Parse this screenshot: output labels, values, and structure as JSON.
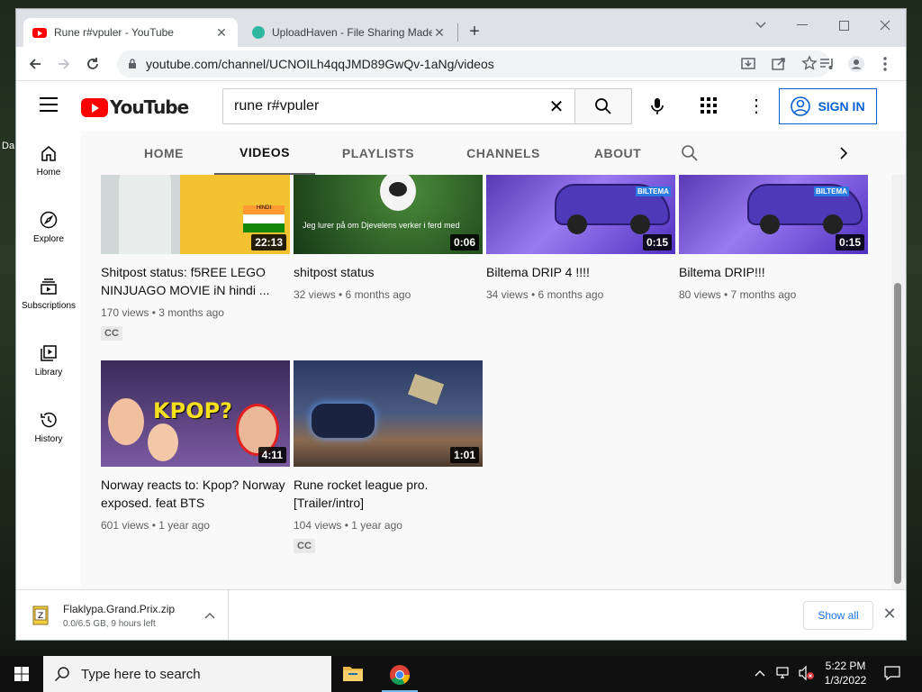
{
  "browser": {
    "tabs": [
      {
        "title": "Rune r#vpuler - YouTube",
        "active": true
      },
      {
        "title": "UploadHaven - File Sharing Made Simple",
        "active": false
      }
    ],
    "url": "youtube.com/channel/UCNOILh4qqJMD89GwQv-1aNg/videos"
  },
  "youtube": {
    "logo_text": "YouTube",
    "search_query": "rune r#vpuler",
    "sign_in_label": "SIGN IN",
    "guide": [
      {
        "label": "Home",
        "icon": "home-icon"
      },
      {
        "label": "Explore",
        "icon": "compass-icon"
      },
      {
        "label": "Subscriptions",
        "icon": "subscriptions-icon"
      },
      {
        "label": "Library",
        "icon": "library-icon"
      },
      {
        "label": "History",
        "icon": "history-icon"
      }
    ],
    "channel_tabs": [
      "HOME",
      "VIDEOS",
      "PLAYLISTS",
      "CHANNELS",
      "ABOUT"
    ],
    "active_tab": "VIDEOS",
    "videos": [
      {
        "title": "Shitpost status: f5REE LEGO NINJUAGO MOVIE iN hindi ...",
        "meta": "170 views • 3 months ago",
        "duration": "22:13",
        "cc": "CC",
        "flag_label": "HINDI",
        "thumb_color": "#f2c230"
      },
      {
        "title": "shitpost status",
        "meta": "32 views • 6 months ago",
        "duration": "0:06",
        "cc": "",
        "caption_text": "Jeg lurer på om Djevelens verker i ferd med å få deg ut av fokus og bort fra",
        "thumb_color": "#2a5a2a"
      },
      {
        "title": "Biltema DRIP 4 !!!!",
        "meta": "34 views • 6 months ago",
        "duration": "0:15",
        "cc": "",
        "badge_text": "BILTEMA",
        "thumb_color": "#6a40d0"
      },
      {
        "title": "Biltema DRIP!!!",
        "meta": "80 views • 7 months ago",
        "duration": "0:15",
        "cc": "",
        "badge_text": "BILTEMA",
        "thumb_color": "#6a40d0"
      },
      {
        "title": "Norway reacts to: Kpop? Norway exposed. feat BTS",
        "meta": "601 views • 1 year ago",
        "duration": "4:11",
        "cc": "",
        "overlay_text": "KPOP?",
        "thumb_color": "#6040a0"
      },
      {
        "title": "Rune rocket league pro. [Trailer/intro]",
        "meta": "104 views • 1 year ago",
        "duration": "1:01",
        "cc": "CC",
        "thumb_color": "#3a4a70"
      }
    ]
  },
  "download": {
    "filename": "Flaklypa.Grand.Prix.zip",
    "status": "0.0/6.5 GB, 9 hours left",
    "show_all_label": "Show all"
  },
  "taskbar": {
    "search_placeholder": "Type here to search",
    "time": "5:22 PM",
    "date": "1/3/2022"
  },
  "desktop": {
    "icon_label": "Da"
  }
}
